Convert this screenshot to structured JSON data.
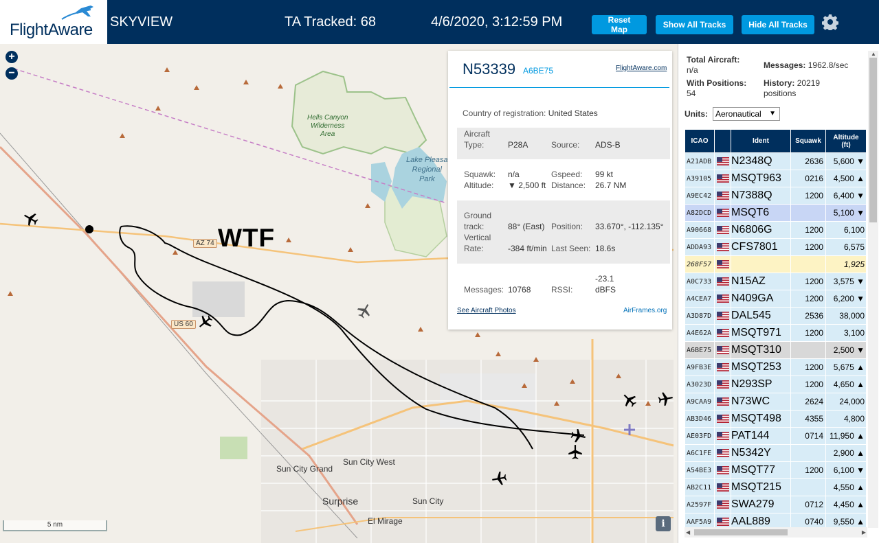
{
  "header": {
    "logo_text": "FlightAware",
    "app_title": "SKYVIEW",
    "tracked_label": "TA Tracked: 68",
    "datetime": "4/6/2020, 3:12:59 PM",
    "buttons": {
      "reset_map": "Reset Map",
      "show_all_tracks": "Show All Tracks",
      "hide_all_tracks": "Hide All Tracks"
    }
  },
  "map": {
    "annotation": "WTF",
    "zoom_in": "+",
    "zoom_out": "−",
    "scale_label": "5 nm",
    "info_button": "i",
    "labels": {
      "hells_canyon": "Hells Canyon\nWilderness\nArea",
      "lake_pleasant": "Lake Pleasa\nRegional\nPark",
      "sun_city_grand": "Sun City Grand",
      "sun_city_west": "Sun City West",
      "surprise": "Surprise",
      "sun_city": "Sun City",
      "el_mirage": "El Mirage",
      "az74": "AZ 74",
      "us60": "US 60"
    }
  },
  "popup": {
    "ident": "N53339",
    "hex": "A6BE75",
    "flightaware_link": "FlightAware.com",
    "country_label": "Country of registration:",
    "country_value": "United States",
    "aircraft_type_label_1": "Aircraft",
    "aircraft_type_label_2": "Type:",
    "aircraft_type_value": "P28A",
    "source_label": "Source:",
    "source_value": "ADS-B",
    "squawk_label": "Squawk:",
    "squawk_value": "n/a",
    "gspeed_label": "Gspeed:",
    "gspeed_value": "99 kt",
    "altitude_label": "Altitude:",
    "altitude_value": "▼ 2,500 ft",
    "distance_label": "Distance:",
    "distance_value": "26.7 NM",
    "ground_track_label_1": "Ground",
    "ground_track_label_2": "track:",
    "ground_track_value": "88° (East)",
    "position_label": "Position:",
    "position_value": "33.670°, -112.135°",
    "vertical_rate_label_1": "Vertical",
    "vertical_rate_label_2": "Rate:",
    "vertical_rate_value": "-384 ft/min",
    "last_seen_label": "Last Seen:",
    "last_seen_value": "18.6s",
    "messages_label": "Messages:",
    "messages_value": "10768",
    "rssi_label": "RSSI:",
    "rssi_value_1": "-23.1",
    "rssi_value_2": "dBFS",
    "photos_link": "See Aircraft Photos",
    "airframes_link": "AirFrames.org"
  },
  "panel": {
    "total_aircraft_label": "Total Aircraft:",
    "total_aircraft_value": "n/a",
    "messages_label": "Messages:",
    "messages_value": "1962.8/sec",
    "with_positions_label": "With Positions:",
    "with_positions_value": "54",
    "history_label": "History:",
    "history_value": "20219",
    "history_unit": "positions",
    "units_label": "Units:",
    "units_value": "Aeronautical",
    "columns": [
      "ICAO",
      "",
      "Ident",
      "Squawk",
      "Altitude\n(ft)"
    ],
    "rows": [
      {
        "icao": "A21ADB",
        "ident": "N2348Q",
        "squawk": "2636",
        "altitude": "5,600 ▼",
        "state": ""
      },
      {
        "icao": "A39105",
        "ident": "MSQT963",
        "squawk": "0216",
        "altitude": "4,500 ▲",
        "state": ""
      },
      {
        "icao": "A9EC42",
        "ident": "N7388Q",
        "squawk": "1200",
        "altitude": "6,400 ▼",
        "state": ""
      },
      {
        "icao": "A82DCD",
        "ident": "MSQT6",
        "squawk": "",
        "altitude": "5,100 ▼",
        "state": "sel"
      },
      {
        "icao": "A90668",
        "ident": "N6806G",
        "squawk": "1200",
        "altitude": "6,100",
        "state": ""
      },
      {
        "icao": "ADDA93",
        "ident": "CFS7801",
        "squawk": "1200",
        "altitude": "6,575",
        "state": ""
      },
      {
        "icao": "268F57",
        "ident": "",
        "squawk": "",
        "altitude": "1,925",
        "state": "nopos"
      },
      {
        "icao": "A0C733",
        "ident": "N15AZ",
        "squawk": "1200",
        "altitude": "3,575 ▼",
        "state": ""
      },
      {
        "icao": "A4CEA7",
        "ident": "N409GA",
        "squawk": "1200",
        "altitude": "6,200 ▼",
        "state": ""
      },
      {
        "icao": "A3D87D",
        "ident": "DAL545",
        "squawk": "2536",
        "altitude": "38,000",
        "state": ""
      },
      {
        "icao": "A4E62A",
        "ident": "MSQT971",
        "squawk": "1200",
        "altitude": "3,100",
        "state": ""
      },
      {
        "icao": "A6BE75",
        "ident": "MSQT310",
        "squawk": "",
        "altitude": "2,500 ▼",
        "state": "hl"
      },
      {
        "icao": "A9FB3E",
        "ident": "MSQT253",
        "squawk": "1200",
        "altitude": "5,675 ▲",
        "state": ""
      },
      {
        "icao": "A3023D",
        "ident": "N293SP",
        "squawk": "1200",
        "altitude": "4,650 ▲",
        "state": ""
      },
      {
        "icao": "A9CAA9",
        "ident": "N73WC",
        "squawk": "2624",
        "altitude": "24,000",
        "state": ""
      },
      {
        "icao": "AB3D46",
        "ident": "MSQT498",
        "squawk": "4355",
        "altitude": "4,800",
        "state": ""
      },
      {
        "icao": "AE03FD",
        "ident": "PAT144",
        "squawk": "0714",
        "altitude": "11,950 ▲",
        "state": ""
      },
      {
        "icao": "A6C1FE",
        "ident": "N5342Y",
        "squawk": "",
        "altitude": "2,900 ▲",
        "state": ""
      },
      {
        "icao": "A54BE3",
        "ident": "MSQT77",
        "squawk": "1200",
        "altitude": "6,100 ▼",
        "state": ""
      },
      {
        "icao": "AB2C11",
        "ident": "MSQT215",
        "squawk": "",
        "altitude": "4,550 ▲",
        "state": ""
      },
      {
        "icao": "A2597F",
        "ident": "SWA279",
        "squawk": "0712",
        "altitude": "4,450 ▲",
        "state": ""
      },
      {
        "icao": "AAF5A9",
        "ident": "AAL889",
        "squawk": "0740",
        "altitude": "9,550 ▲",
        "state": ""
      }
    ]
  },
  "colors": {
    "header_bg": "#002f5d",
    "button_bg": "#0099e0",
    "row_bg": "#d8ecf7",
    "selected_row_bg": "#c8d6f5",
    "no_position_row_bg": "#fdf3c4",
    "highlight_row_bg": "#d8d8d8"
  },
  "icons": [
    "logo-plane-icon",
    "gear-icon",
    "aircraft-icon",
    "us-flag-icon",
    "info-icon"
  ]
}
